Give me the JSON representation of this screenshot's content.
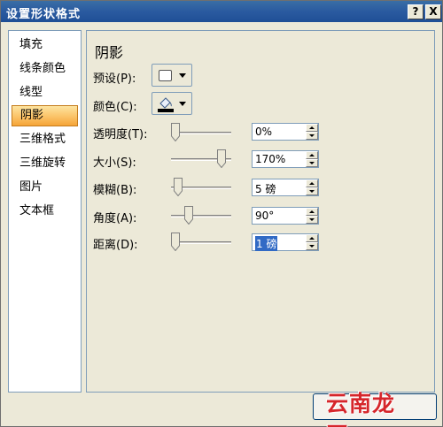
{
  "window": {
    "title": "设置形状格式",
    "help_label": "?",
    "close_label": "X"
  },
  "nav": {
    "items": [
      {
        "label": "填充",
        "selected": false
      },
      {
        "label": "线条颜色",
        "selected": false
      },
      {
        "label": "线型",
        "selected": false
      },
      {
        "label": "阴影",
        "selected": true
      },
      {
        "label": "三维格式",
        "selected": false
      },
      {
        "label": "三维旋转",
        "selected": false
      },
      {
        "label": "图片",
        "selected": false
      },
      {
        "label": "文本框",
        "selected": false
      }
    ]
  },
  "panel": {
    "title": "阴影",
    "preset": {
      "label": "预设(P):",
      "icon": "shadow-preset-icon"
    },
    "color": {
      "label": "颜色(C):",
      "icon": "paint-bucket-icon",
      "value": "#000000"
    },
    "settings": [
      {
        "key": "transparency",
        "label": "透明度(T):",
        "value": "0%",
        "slider_fraction": 0.0,
        "selected": false
      },
      {
        "key": "size",
        "label": "大小(S):",
        "value": "170%",
        "slider_fraction": 0.85,
        "selected": false
      },
      {
        "key": "blur",
        "label": "模糊(B):",
        "value": "5 磅",
        "slider_fraction": 0.05,
        "selected": false
      },
      {
        "key": "angle",
        "label": "角度(A):",
        "value": "90°",
        "slider_fraction": 0.25,
        "selected": false
      },
      {
        "key": "distance",
        "label": "距离(D):",
        "value": "1 磅",
        "slider_fraction": 0.0,
        "selected": true
      }
    ]
  },
  "watermark": {
    "text": "云南龙网"
  }
}
